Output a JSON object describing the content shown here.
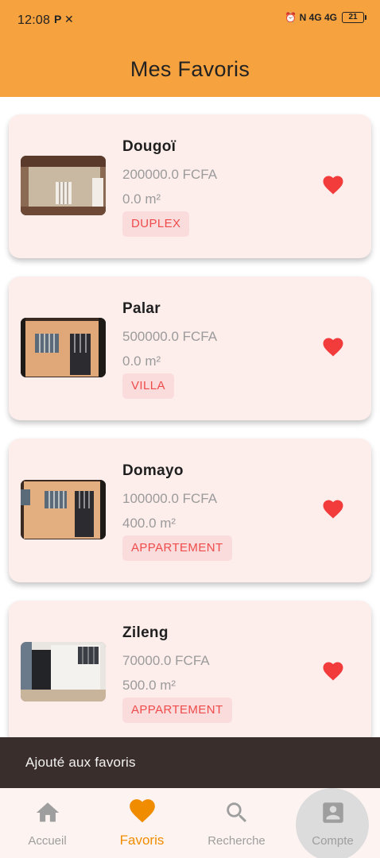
{
  "status_bar": {
    "time": "12:08",
    "left_icons": "P ✕",
    "right_icons": "⏰ N 4G 4G",
    "battery": "21"
  },
  "app_bar": {
    "title": "Mes Favoris"
  },
  "favorites": [
    {
      "name": "Dougoï",
      "price": "200000.0 FCFA",
      "area": "0.0 m²",
      "type": "DUPLEX",
      "favorited": true,
      "thumbnail_icon": "room-interior-photo"
    },
    {
      "name": "Palar",
      "price": "500000.0 FCFA",
      "area": "0.0 m²",
      "type": "VILLA",
      "favorited": true,
      "thumbnail_icon": "house-facade-photo"
    },
    {
      "name": "Domayo",
      "price": "100000.0 FCFA",
      "area": "400.0 m²",
      "type": "APPARTEMENT",
      "favorited": true,
      "thumbnail_icon": "house-facade-photo"
    },
    {
      "name": "Zileng",
      "price": "70000.0 FCFA",
      "area": "500.0 m²",
      "type": "APPARTEMENT",
      "favorited": true,
      "thumbnail_icon": "courtyard-photo"
    }
  ],
  "snackbar": {
    "message": "Ajouté aux favoris"
  },
  "bottom_nav": {
    "items": [
      {
        "label": "Accueil",
        "icon": "home-icon",
        "active": false
      },
      {
        "label": "Favoris",
        "icon": "heart-icon",
        "active": true
      },
      {
        "label": "Recherche",
        "icon": "search-icon",
        "active": false
      },
      {
        "label": "Compte",
        "icon": "account-icon",
        "active": false
      }
    ]
  },
  "colors": {
    "primary": "#f6a23f",
    "card_bg": "#fdeeec",
    "badge_bg": "#fbdcdc",
    "badge_text": "#ee4b4b",
    "heart": "#f23b3b",
    "nav_active": "#f08c00",
    "snackbar_bg": "#3a2e2c"
  }
}
